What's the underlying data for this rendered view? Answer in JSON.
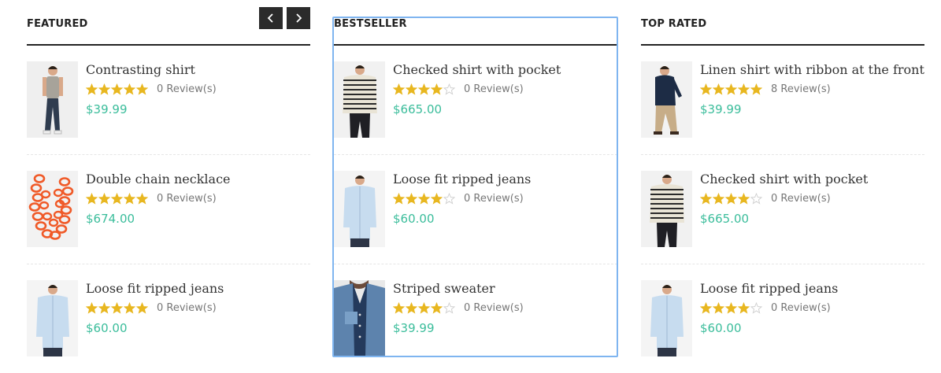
{
  "colors": {
    "accent": "#3bbd9b",
    "star_gold": "#e8b720",
    "star_empty": "#cfcfcf",
    "header_rule": "#222222",
    "nav_bg": "#2b2b2b",
    "selection": "#7fb5f0"
  },
  "nav": {
    "prev_icon": "chevron-left-icon",
    "next_icon": "chevron-right-icon"
  },
  "columns": [
    {
      "title": "FEATURED",
      "products": [
        {
          "name": "Contrasting shirt",
          "rating": 5,
          "reviews": "0 Review(s)",
          "price": "$39.99",
          "image": "man-grey-tee-jeans"
        },
        {
          "name": "Double chain necklace",
          "rating": 5,
          "reviews": "0 Review(s)",
          "price": "$674.00",
          "image": "orange-chain-necklace"
        },
        {
          "name": "Loose fit ripped jeans",
          "rating": 5,
          "reviews": "0 Review(s)",
          "price": "$60.00",
          "image": "man-light-blue-shirt"
        }
      ]
    },
    {
      "title": "BESTSELLER",
      "products": [
        {
          "name": "Checked shirt with pocket",
          "rating": 4,
          "reviews": "0 Review(s)",
          "price": "$665.00",
          "image": "man-striped-sweater"
        },
        {
          "name": "Loose fit ripped jeans",
          "rating": 4,
          "reviews": "0 Review(s)",
          "price": "$60.00",
          "image": "man-light-blue-shirt"
        },
        {
          "name": "Striped sweater",
          "rating": 4,
          "reviews": "0 Review(s)",
          "price": "$39.99",
          "image": "denim-shirt-closeup"
        }
      ]
    },
    {
      "title": "TOP RATED",
      "products": [
        {
          "name": "Linen shirt with ribbon at the front",
          "rating": 5,
          "reviews": "8 Review(s)",
          "price": "$39.99",
          "image": "man-navy-shirt-chinos"
        },
        {
          "name": "Checked shirt with pocket",
          "rating": 4,
          "reviews": "0 Review(s)",
          "price": "$665.00",
          "image": "man-striped-sweater"
        },
        {
          "name": "Loose fit ripped jeans",
          "rating": 4,
          "reviews": "0 Review(s)",
          "price": "$60.00",
          "image": "man-light-blue-shirt"
        }
      ]
    }
  ]
}
